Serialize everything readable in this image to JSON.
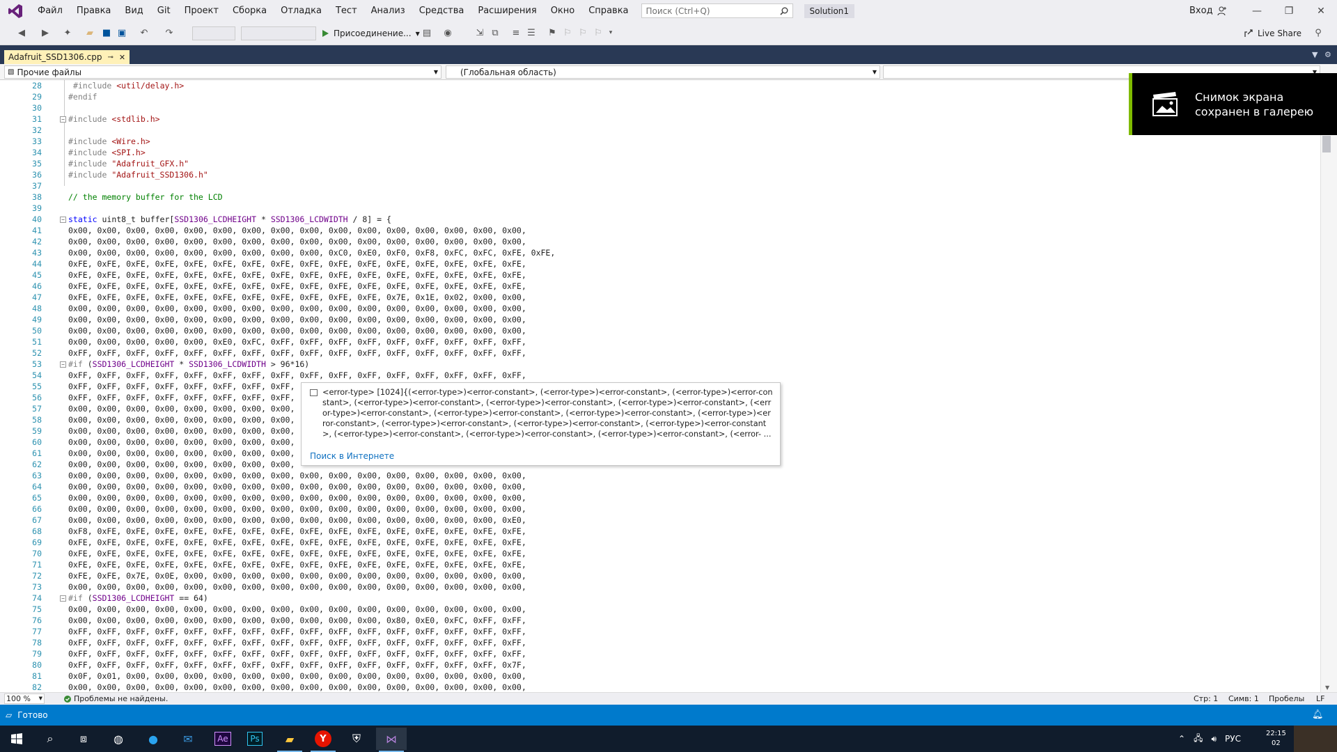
{
  "window": {
    "menu": [
      "Файл",
      "Правка",
      "Вид",
      "Git",
      "Проект",
      "Сборка",
      "Отладка",
      "Тест",
      "Анализ",
      "Средства",
      "Расширения",
      "Окно",
      "Справка"
    ],
    "search_placeholder": "Поиск (Ctrl+Q)",
    "solution": "Solution1",
    "signin": "Вход"
  },
  "toolbar": {
    "attach_label": "Присоединение...",
    "liveshare_label": "Live Share"
  },
  "tab": {
    "filename": "Adafruit_SSD1306.cpp",
    "pin": "⊸",
    "close": "✕"
  },
  "nav": {
    "project": "Прочие файлы",
    "scope": "(Глобальная область)"
  },
  "toast": {
    "text": "Снимок экрана сохранен в галерею"
  },
  "tooltip": {
    "text": "<error-type> [1024]{(<error-type>)<error-constant>, (<error-type>)<error-constant>, (<error-type>)<error-constant>, (<error-type>)<error-constant>, (<error-type>)<error-constant>, (<error-type>)<error-constant>, (<error-type>)<error-constant>, (<error-type>)<error-constant>, (<error-type>)<error-constant>, (<error-type>)<error-constant>, (<error-type>)<error-constant>, (<error-type>)<error-constant>, (<error-type>)<error-constant>, (<error-type>)<error-constant>, (<error-type>)<error-constant>, (<error-type>)<error-constant>, (<error- ...",
    "link": "Поиск в Интернете"
  },
  "code": {
    "lines": [
      {
        "n": 28,
        "c": " #include <util/delay.h>",
        "t": "inc",
        "a": " <util/delay.h>"
      },
      {
        "n": 29,
        "c": "#endif",
        "t": "pp"
      },
      {
        "n": 30,
        "c": "",
        "t": "plain"
      },
      {
        "n": 31,
        "c": "#include <stdlib.h>",
        "t": "inc",
        "a": " <stdlib.h>",
        "fold": true
      },
      {
        "n": 32,
        "c": "",
        "t": "plain"
      },
      {
        "n": 33,
        "c": "#include <Wire.h>",
        "t": "inc",
        "a": " <Wire.h>"
      },
      {
        "n": 34,
        "c": "#include <SPI.h>",
        "t": "inc",
        "a": " <SPI.h>"
      },
      {
        "n": 35,
        "c": "#include \"Adafruit_GFX.h\"",
        "t": "inc",
        "a": " \"Adafruit_GFX.h\""
      },
      {
        "n": 36,
        "c": "#include \"Adafruit_SSD1306.h\"",
        "t": "inc",
        "a": " \"Adafruit_SSD1306.h\""
      },
      {
        "n": 37,
        "c": "",
        "t": "plain"
      },
      {
        "n": 38,
        "c": "// the memory buffer for the LCD",
        "t": "cm"
      },
      {
        "n": 39,
        "c": "",
        "t": "plain"
      },
      {
        "n": 40,
        "c": "static uint8_t buffer[SSD1306_LCDHEIGHT * SSD1306_LCDWIDTH / 8] = {",
        "t": "decl",
        "fold": true
      },
      {
        "n": 41,
        "c": "0x00, 0x00, 0x00, 0x00, 0x00, 0x00, 0x00, 0x00, 0x00, 0x00, 0x00, 0x00, 0x00, 0x00, 0x00, 0x00,",
        "t": "plain"
      },
      {
        "n": 42,
        "c": "0x00, 0x00, 0x00, 0x00, 0x00, 0x00, 0x00, 0x00, 0x00, 0x00, 0x00, 0x00, 0x00, 0x00, 0x00, 0x00,",
        "t": "plain"
      },
      {
        "n": 43,
        "c": "0x00, 0x00, 0x00, 0x00, 0x00, 0x00, 0x00, 0x00, 0x00, 0xC0, 0xE0, 0xF0, 0xF8, 0xFC, 0xFC, 0xFE, 0xFE,",
        "t": "plain"
      },
      {
        "n": 44,
        "c": "0xFE, 0xFE, 0xFE, 0xFE, 0xFE, 0xFE, 0xFE, 0xFE, 0xFE, 0xFE, 0xFE, 0xFE, 0xFE, 0xFE, 0xFE, 0xFE,",
        "t": "plain"
      },
      {
        "n": 45,
        "c": "0xFE, 0xFE, 0xFE, 0xFE, 0xFE, 0xFE, 0xFE, 0xFE, 0xFE, 0xFE, 0xFE, 0xFE, 0xFE, 0xFE, 0xFE, 0xFE,",
        "t": "plain"
      },
      {
        "n": 46,
        "c": "0xFE, 0xFE, 0xFE, 0xFE, 0xFE, 0xFE, 0xFE, 0xFE, 0xFE, 0xFE, 0xFE, 0xFE, 0xFE, 0xFE, 0xFE, 0xFE,",
        "t": "plain"
      },
      {
        "n": 47,
        "c": "0xFE, 0xFE, 0xFE, 0xFE, 0xFE, 0xFE, 0xFE, 0xFE, 0xFE, 0xFE, 0xFE, 0x7E, 0x1E, 0x02, 0x00, 0x00,",
        "t": "plain"
      },
      {
        "n": 48,
        "c": "0x00, 0x00, 0x00, 0x00, 0x00, 0x00, 0x00, 0x00, 0x00, 0x00, 0x00, 0x00, 0x00, 0x00, 0x00, 0x00,",
        "t": "plain"
      },
      {
        "n": 49,
        "c": "0x00, 0x00, 0x00, 0x00, 0x00, 0x00, 0x00, 0x00, 0x00, 0x00, 0x00, 0x00, 0x00, 0x00, 0x00, 0x00,",
        "t": "plain"
      },
      {
        "n": 50,
        "c": "0x00, 0x00, 0x00, 0x00, 0x00, 0x00, 0x00, 0x00, 0x00, 0x00, 0x00, 0x00, 0x00, 0x00, 0x00, 0x00,",
        "t": "plain"
      },
      {
        "n": 51,
        "c": "0x00, 0x00, 0x00, 0x00, 0x00, 0xE0, 0xFC, 0xFF, 0xFF, 0xFF, 0xFF, 0xFF, 0xFF, 0xFF, 0xFF, 0xFF,",
        "t": "plain"
      },
      {
        "n": 52,
        "c": "0xFF, 0xFF, 0xFF, 0xFF, 0xFF, 0xFF, 0xFF, 0xFF, 0xFF, 0xFF, 0xFF, 0xFF, 0xFF, 0xFF, 0xFF, 0xFF,",
        "t": "plain"
      },
      {
        "n": 53,
        "c": "#if (SSD1306_LCDHEIGHT * SSD1306_LCDWIDTH > 96*16)",
        "t": "if1",
        "fold": true
      },
      {
        "n": 54,
        "c": "0xFF, 0xFF, 0xFF, 0xFF, 0xFF, 0xFF, 0xFF, 0xFF, 0xFF, 0xFF, 0xFF, 0xFF, 0xFF, 0xFF, 0xFF, 0xFF,",
        "t": "plain"
      },
      {
        "n": 55,
        "c": "0xFF, 0xFF, 0xFF, 0xFF, 0xFF, 0xFF, 0xFF, 0xFF,",
        "t": "plain"
      },
      {
        "n": 56,
        "c": "0xFF, 0xFF, 0xFF, 0xFF, 0xFF, 0xFF, 0xFF, 0xFF,",
        "t": "plain"
      },
      {
        "n": 57,
        "c": "0x00, 0x00, 0x00, 0x00, 0x00, 0x00, 0x00, 0x00,",
        "t": "plain"
      },
      {
        "n": 58,
        "c": "0x00, 0x00, 0x00, 0x00, 0x00, 0x00, 0x00, 0x00,",
        "t": "plain"
      },
      {
        "n": 59,
        "c": "0x00, 0x00, 0x00, 0x00, 0x00, 0x00, 0x00, 0x00,",
        "t": "plain"
      },
      {
        "n": 60,
        "c": "0x00, 0x00, 0x00, 0x00, 0x00, 0x00, 0x00, 0x00,",
        "t": "plain"
      },
      {
        "n": 61,
        "c": "0x00, 0x00, 0x00, 0x00, 0x00, 0x00, 0x00, 0x00,",
        "t": "plain"
      },
      {
        "n": 62,
        "c": "0x00, 0x00, 0x00, 0x00, 0x00, 0x00, 0x00, 0x00,",
        "t": "plain"
      },
      {
        "n": 63,
        "c": "0x00, 0x00, 0x00, 0x00, 0x00, 0x00, 0x00, 0x00, 0x00, 0x00, 0x00, 0x00, 0x00, 0x00, 0x00, 0x00,",
        "t": "plain"
      },
      {
        "n": 64,
        "c": "0x00, 0x00, 0x00, 0x00, 0x00, 0x00, 0x00, 0x00, 0x00, 0x00, 0x00, 0x00, 0x00, 0x00, 0x00, 0x00,",
        "t": "plain"
      },
      {
        "n": 65,
        "c": "0x00, 0x00, 0x00, 0x00, 0x00, 0x00, 0x00, 0x00, 0x00, 0x00, 0x00, 0x00, 0x00, 0x00, 0x00, 0x00,",
        "t": "plain"
      },
      {
        "n": 66,
        "c": "0x00, 0x00, 0x00, 0x00, 0x00, 0x00, 0x00, 0x00, 0x00, 0x00, 0x00, 0x00, 0x00, 0x00, 0x00, 0x00,",
        "t": "plain"
      },
      {
        "n": 67,
        "c": "0x00, 0x00, 0x00, 0x00, 0x00, 0x00, 0x00, 0x00, 0x00, 0x00, 0x00, 0x00, 0x00, 0x00, 0x00, 0xE0,",
        "t": "plain"
      },
      {
        "n": 68,
        "c": "0xF8, 0xFE, 0xFE, 0xFE, 0xFE, 0xFE, 0xFE, 0xFE, 0xFE, 0xFE, 0xFE, 0xFE, 0xFE, 0xFE, 0xFE, 0xFE,",
        "t": "plain"
      },
      {
        "n": 69,
        "c": "0xFE, 0xFE, 0xFE, 0xFE, 0xFE, 0xFE, 0xFE, 0xFE, 0xFE, 0xFE, 0xFE, 0xFE, 0xFE, 0xFE, 0xFE, 0xFE,",
        "t": "plain"
      },
      {
        "n": 70,
        "c": "0xFE, 0xFE, 0xFE, 0xFE, 0xFE, 0xFE, 0xFE, 0xFE, 0xFE, 0xFE, 0xFE, 0xFE, 0xFE, 0xFE, 0xFE, 0xFE,",
        "t": "plain"
      },
      {
        "n": 71,
        "c": "0xFE, 0xFE, 0xFE, 0xFE, 0xFE, 0xFE, 0xFE, 0xFE, 0xFE, 0xFE, 0xFE, 0xFE, 0xFE, 0xFE, 0xFE, 0xFE,",
        "t": "plain"
      },
      {
        "n": 72,
        "c": "0xFE, 0xFE, 0x7E, 0x0E, 0x00, 0x00, 0x00, 0x00, 0x00, 0x00, 0x00, 0x00, 0x00, 0x00, 0x00, 0x00,",
        "t": "plain"
      },
      {
        "n": 73,
        "c": "0x00, 0x00, 0x00, 0x00, 0x00, 0x00, 0x00, 0x00, 0x00, 0x00, 0x00, 0x00, 0x00, 0x00, 0x00, 0x00,",
        "t": "plain"
      },
      {
        "n": 74,
        "c": "#if (SSD1306_LCDHEIGHT == 64)",
        "t": "if2",
        "fold": true
      },
      {
        "n": 75,
        "c": "0x00, 0x00, 0x00, 0x00, 0x00, 0x00, 0x00, 0x00, 0x00, 0x00, 0x00, 0x00, 0x00, 0x00, 0x00, 0x00,",
        "t": "plain"
      },
      {
        "n": 76,
        "c": "0x00, 0x00, 0x00, 0x00, 0x00, 0x00, 0x00, 0x00, 0x00, 0x00, 0x00, 0x80, 0xE0, 0xFC, 0xFF, 0xFF,",
        "t": "plain"
      },
      {
        "n": 77,
        "c": "0xFF, 0xFF, 0xFF, 0xFF, 0xFF, 0xFF, 0xFF, 0xFF, 0xFF, 0xFF, 0xFF, 0xFF, 0xFF, 0xFF, 0xFF, 0xFF,",
        "t": "plain"
      },
      {
        "n": 78,
        "c": "0xFF, 0xFF, 0xFF, 0xFF, 0xFF, 0xFF, 0xFF, 0xFF, 0xFF, 0xFF, 0xFF, 0xFF, 0xFF, 0xFF, 0xFF, 0xFF,",
        "t": "plain"
      },
      {
        "n": 79,
        "c": "0xFF, 0xFF, 0xFF, 0xFF, 0xFF, 0xFF, 0xFF, 0xFF, 0xFF, 0xFF, 0xFF, 0xFF, 0xFF, 0xFF, 0xFF, 0xFF,",
        "t": "plain"
      },
      {
        "n": 80,
        "c": "0xFF, 0xFF, 0xFF, 0xFF, 0xFF, 0xFF, 0xFF, 0xFF, 0xFF, 0xFF, 0xFF, 0xFF, 0xFF, 0xFF, 0xFF, 0x7F,",
        "t": "plain"
      },
      {
        "n": 81,
        "c": "0x0F, 0x01, 0x00, 0x00, 0x00, 0x00, 0x00, 0x00, 0x00, 0x00, 0x00, 0x00, 0x00, 0x00, 0x00, 0x00,",
        "t": "plain"
      },
      {
        "n": 82,
        "c": "0x00, 0x00, 0x00, 0x00, 0x00, 0x00, 0x00, 0x00, 0x00, 0x00, 0x00, 0x00, 0x00, 0x00, 0x00, 0x00,",
        "t": "plain"
      }
    ]
  },
  "editor_status": {
    "zoom": "100 %",
    "problems": "Проблемы не найдены.",
    "line": "Стр: 1",
    "col": "Симв: 1",
    "spaces": "Пробелы",
    "eol": "LF"
  },
  "statusbar": {
    "text": "Готово"
  },
  "taskbar": {
    "lang": "РУС",
    "time": "22:15",
    "date": "02"
  },
  "colors": {
    "accent": "#007acc",
    "keyword": "#0000ff",
    "macro": "#6f008a",
    "string": "#a31515",
    "comment": "#008000",
    "line_number": "#2b91af"
  }
}
